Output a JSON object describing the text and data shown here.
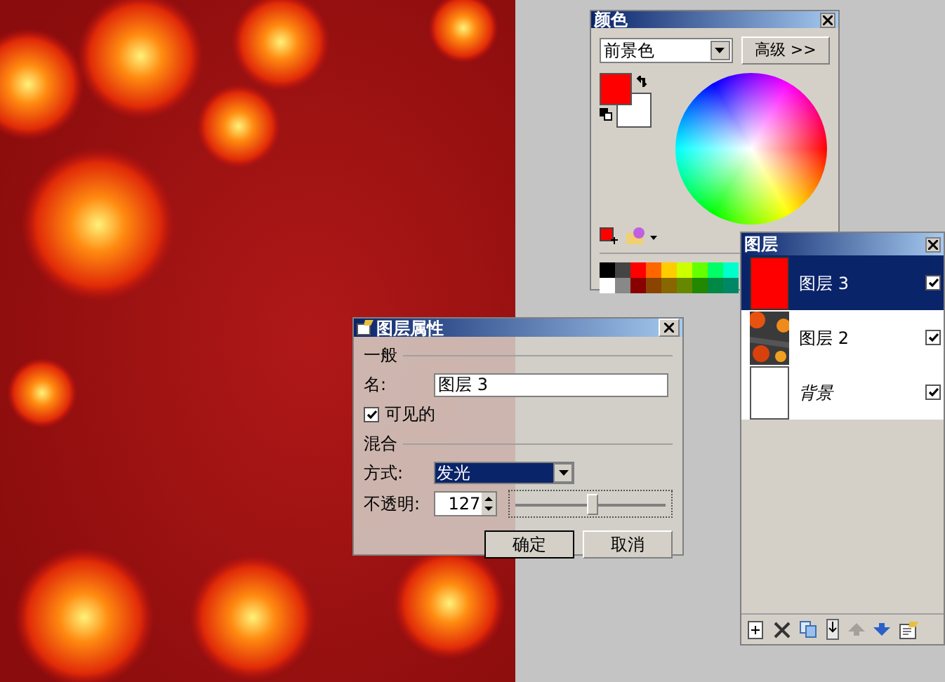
{
  "colors_panel": {
    "title": "颜色",
    "target": "前景色",
    "more_button": "高级 >>"
  },
  "layers_panel": {
    "title": "图层",
    "layers": [
      {
        "name": "图层 3",
        "kind": "solid",
        "selected": true,
        "visible": true
      },
      {
        "name": "图层 2",
        "kind": "picture",
        "selected": false,
        "visible": true
      },
      {
        "name": "背景",
        "kind": "background",
        "selected": false,
        "visible": true
      }
    ],
    "tools": [
      {
        "kind": "add",
        "disabled": false
      },
      {
        "kind": "delete",
        "disabled": false
      },
      {
        "kind": "duplicate",
        "disabled": false
      },
      {
        "kind": "merge",
        "disabled": false
      },
      {
        "kind": "up",
        "disabled": true
      },
      {
        "kind": "down",
        "disabled": false
      },
      {
        "kind": "properties",
        "disabled": false
      }
    ]
  },
  "dialog": {
    "title": "图层属性",
    "general_section": "一般",
    "name_label": "名:",
    "name_value": "图层 3",
    "visible": {
      "label": "可见的",
      "checked": true
    },
    "blend_section": "混合",
    "mode_label": "方式:",
    "mode_value": "发光",
    "opacity_label": "不透明:",
    "opacity_value": "127",
    "opacity_slider": {
      "level": 0.5
    },
    "ok_button": "确定",
    "cancel_button": "取消"
  }
}
